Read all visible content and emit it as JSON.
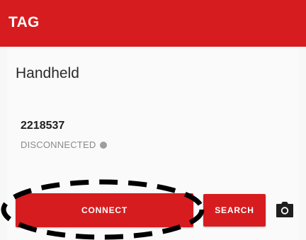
{
  "appbar": {
    "title": "TAG"
  },
  "main": {
    "section_title": "Handheld",
    "device": {
      "id": "2218537",
      "status": "DISCONNECTED",
      "status_color": "#9e9e9e"
    },
    "actions": {
      "connect_label": "CONNECT",
      "search_label": "SEARCH",
      "camera_icon": "camera-icon"
    }
  },
  "colors": {
    "accent": "#d71c1f",
    "background": "#f7f7f7",
    "annotation": "#000000"
  }
}
